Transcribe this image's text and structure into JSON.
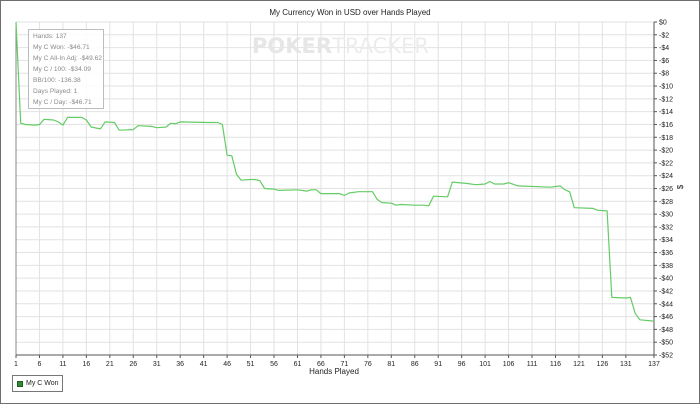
{
  "chart_data": {
    "type": "line",
    "title": "My Currency Won in USD over Hands Played",
    "xlabel": "Hands Played",
    "ylabel": "$",
    "xlim": [
      1,
      137
    ],
    "ylim": [
      -52,
      0
    ],
    "x_ticks": [
      1,
      6,
      11,
      16,
      21,
      26,
      31,
      36,
      41,
      46,
      51,
      56,
      61,
      66,
      71,
      76,
      81,
      86,
      91,
      96,
      101,
      106,
      111,
      116,
      121,
      126,
      131,
      137
    ],
    "y_ticks": [
      0,
      -2,
      -4,
      -6,
      -8,
      -10,
      -12,
      -14,
      -16,
      -18,
      -20,
      -22,
      -24,
      -26,
      -28,
      -30,
      -32,
      -34,
      -36,
      -38,
      -40,
      -42,
      -44,
      -46,
      -48,
      -50,
      -52
    ],
    "y_tick_labels": [
      "$0",
      "-$2",
      "-$4",
      "-$6",
      "-$8",
      "-$10",
      "-$12",
      "-$14",
      "-$16",
      "-$18",
      "-$20",
      "-$22",
      "-$24",
      "-$26",
      "-$28",
      "-$30",
      "-$32",
      "-$34",
      "-$36",
      "-$38",
      "-$40",
      "-$42",
      "-$44",
      "-$46",
      "-$48",
      "-$50",
      "-$52"
    ],
    "grid": true,
    "series": [
      {
        "name": "My C Won",
        "color": "#64cc64",
        "points": [
          [
            1,
            0
          ],
          [
            2,
            -15.8
          ],
          [
            3,
            -16.0
          ],
          [
            5,
            -16.1
          ],
          [
            6,
            -16.0
          ],
          [
            7,
            -15.2
          ],
          [
            9,
            -15.3
          ],
          [
            10,
            -15.6
          ],
          [
            11,
            -16.1
          ],
          [
            12,
            -14.9
          ],
          [
            15,
            -14.9
          ],
          [
            16,
            -15.3
          ],
          [
            17,
            -16.4
          ],
          [
            19,
            -16.7
          ],
          [
            20,
            -15.6
          ],
          [
            22,
            -15.7
          ],
          [
            23,
            -16.9
          ],
          [
            26,
            -16.8
          ],
          [
            27,
            -16.2
          ],
          [
            30,
            -16.3
          ],
          [
            31,
            -16.5
          ],
          [
            33,
            -16.4
          ],
          [
            34,
            -15.8
          ],
          [
            35,
            -15.9
          ],
          [
            36,
            -15.6
          ],
          [
            42,
            -15.7
          ],
          [
            44,
            -15.7
          ],
          [
            45,
            -16.0
          ],
          [
            46,
            -20.8
          ],
          [
            47,
            -20.9
          ],
          [
            48,
            -23.8
          ],
          [
            49,
            -24.7
          ],
          [
            51,
            -24.6
          ],
          [
            52,
            -24.6
          ],
          [
            53,
            -24.8
          ],
          [
            54,
            -26.0
          ],
          [
            56,
            -26.1
          ],
          [
            57,
            -26.3
          ],
          [
            61,
            -26.2
          ],
          [
            63,
            -26.4
          ],
          [
            64,
            -26.2
          ],
          [
            65,
            -26.2
          ],
          [
            66,
            -26.8
          ],
          [
            70,
            -26.8
          ],
          [
            71,
            -27.1
          ],
          [
            72,
            -26.7
          ],
          [
            74,
            -26.5
          ],
          [
            77,
            -26.5
          ],
          [
            78,
            -27.7
          ],
          [
            79,
            -28.2
          ],
          [
            81,
            -28.3
          ],
          [
            82,
            -28.6
          ],
          [
            83,
            -28.5
          ],
          [
            86,
            -28.6
          ],
          [
            88,
            -28.6
          ],
          [
            89,
            -28.7
          ],
          [
            90,
            -27.2
          ],
          [
            93,
            -27.3
          ],
          [
            94,
            -25.0
          ],
          [
            97,
            -25.2
          ],
          [
            99,
            -25.4
          ],
          [
            101,
            -25.3
          ],
          [
            102,
            -24.9
          ],
          [
            103,
            -25.3
          ],
          [
            105,
            -25.3
          ],
          [
            106,
            -25.1
          ],
          [
            108,
            -25.6
          ],
          [
            115,
            -25.8
          ],
          [
            117,
            -25.6
          ],
          [
            118,
            -26.2
          ],
          [
            119,
            -26.5
          ],
          [
            120,
            -29.0
          ],
          [
            124,
            -29.1
          ],
          [
            125,
            -29.4
          ],
          [
            127,
            -29.5
          ],
          [
            128,
            -43.0
          ],
          [
            131,
            -43.1
          ],
          [
            132,
            -43.0
          ],
          [
            133,
            -45.5
          ],
          [
            134,
            -46.5
          ],
          [
            137,
            -46.71
          ]
        ]
      }
    ],
    "legend": {
      "position": "bottom-left",
      "entries": [
        "My C Won"
      ]
    }
  },
  "stats": {
    "hands": "Hands: 137",
    "won": "My C Won: -$46.71",
    "allin_adj": "My C All-In Adj: -$49.62",
    "per100": "My C / 100: -$34.09",
    "bb100": "BB/100: -136.38",
    "days": "Days Played: 1",
    "per_day": "My C / Day: -$46.71"
  },
  "watermark": {
    "left": "POKER",
    "right": "TRACKER"
  }
}
